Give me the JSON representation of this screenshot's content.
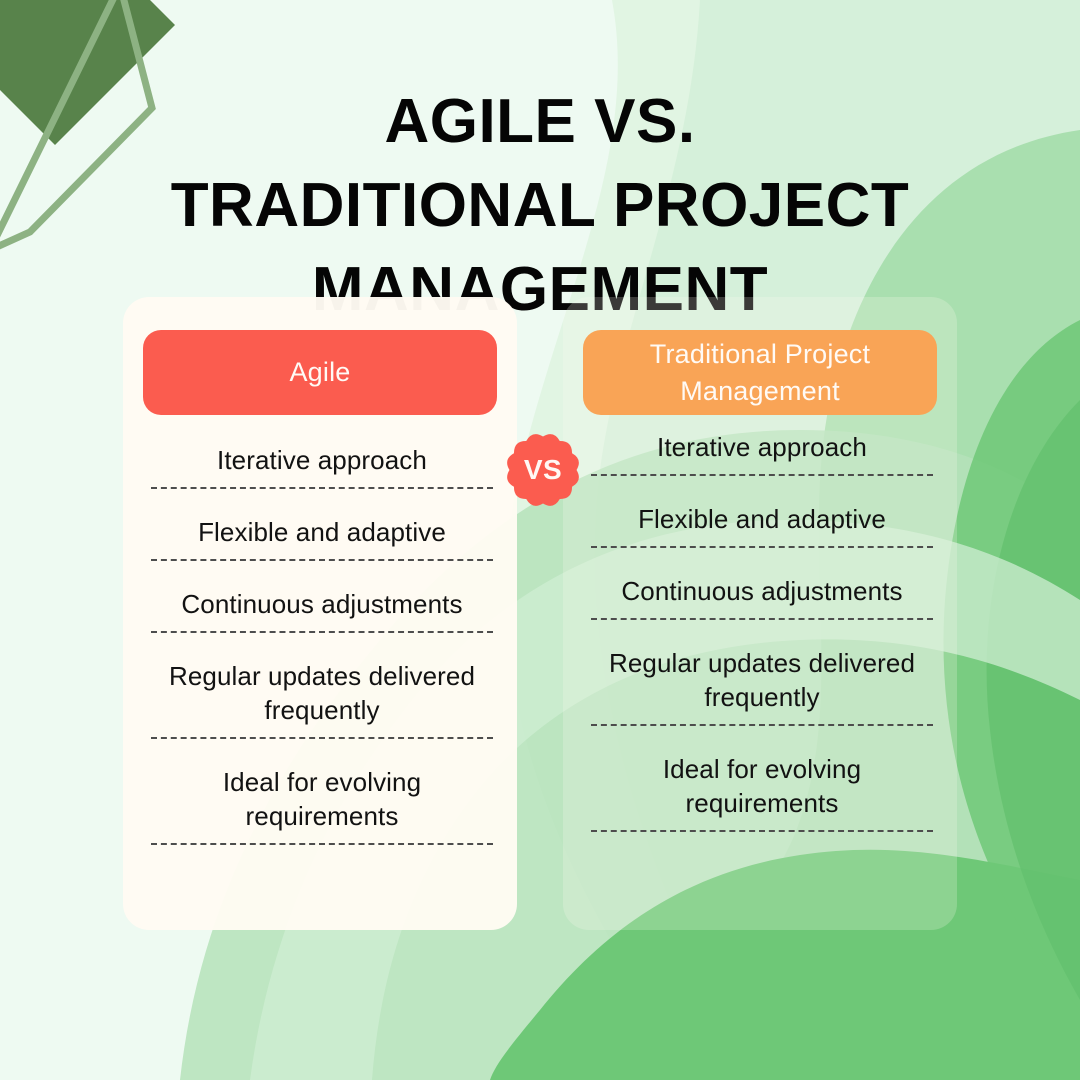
{
  "title": "AGILE VS.\nTRADITIONAL PROJECT\nMANAGEMENT",
  "badge": {
    "label": "VS"
  },
  "colors": {
    "background": "#eefaf2",
    "card_cream": "#fffbf3",
    "agile_pill": "#fb5c4f",
    "traditional_pill": "#f9a456",
    "badge_red": "#fb5c4f",
    "title_text": "#050505",
    "item_text": "#121212",
    "divider": "#4d4d4d",
    "green_dark": "#58834b",
    "green_mid": "#6fc878",
    "green_light": "#a9dfae",
    "green_pale": "#cfeed3"
  },
  "columns": [
    {
      "key": "agile",
      "header": "Agile",
      "items": [
        "Iterative approach",
        "Flexible and adaptive",
        "Continuous adjustments",
        "Regular updates delivered frequently",
        "Ideal for evolving requirements"
      ]
    },
    {
      "key": "traditional",
      "header": "Traditional Project Management",
      "items": [
        "Iterative approach",
        "Flexible and adaptive",
        "Continuous adjustments",
        "Regular updates delivered frequently",
        "Ideal for evolving requirements"
      ]
    }
  ]
}
